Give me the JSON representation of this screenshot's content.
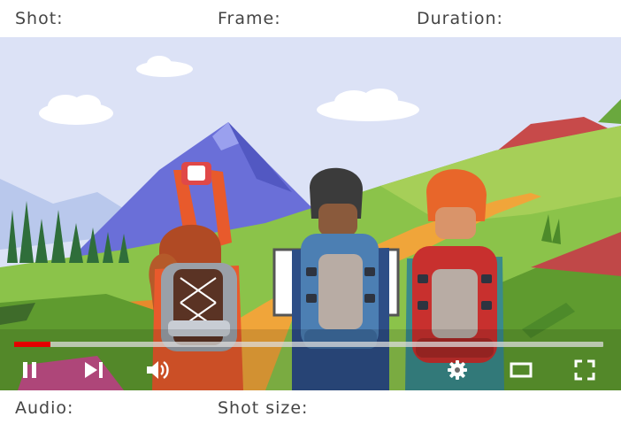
{
  "metadata": {
    "shot_label": "Shot:",
    "frame_label": "Frame:",
    "duration_label": "Duration:",
    "audio_label": "Audio:",
    "shot_size_label": "Shot size:"
  },
  "player": {
    "progress_fraction": 0.062,
    "colors": {
      "progress_fill": "#e50000",
      "progress_track": "#d9d9d9",
      "controls": "#ffffff"
    },
    "controls": {
      "play_pause": "pause-icon",
      "next": "skip-next-icon",
      "volume": "volume-icon",
      "settings": "gear-icon",
      "theater": "theater-mode-icon",
      "fullscreen": "fullscreen-icon"
    }
  }
}
